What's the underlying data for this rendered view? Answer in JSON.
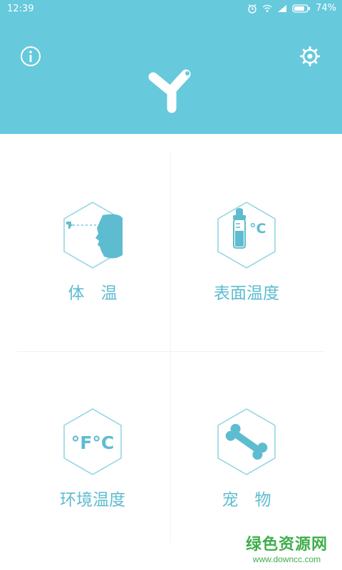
{
  "status_bar": {
    "time": "12:39",
    "battery": "74%",
    "icons": [
      "alarm-icon",
      "wifi-icon",
      "signal-icon",
      "battery-icon"
    ]
  },
  "header": {
    "info_icon": "info-icon",
    "settings_icon": "gear-icon",
    "logo": "y-logo"
  },
  "menu": [
    {
      "label": "体　温",
      "icon": "forehead-thermometer-icon"
    },
    {
      "label": "表面温度",
      "icon": "bottle-temperature-icon",
      "icon_text": "°C"
    },
    {
      "label": "环境温度",
      "icon": "fahrenheit-celsius-icon",
      "icon_text": "°F°C"
    },
    {
      "label": "宠　物",
      "icon": "bone-icon"
    }
  ],
  "watermark": {
    "title": "绿色资源网",
    "url": "www.downcc.com"
  },
  "colors": {
    "header_bg": "#66c9dc",
    "accent": "#5ebcd0",
    "watermark": "#3fae4b"
  }
}
